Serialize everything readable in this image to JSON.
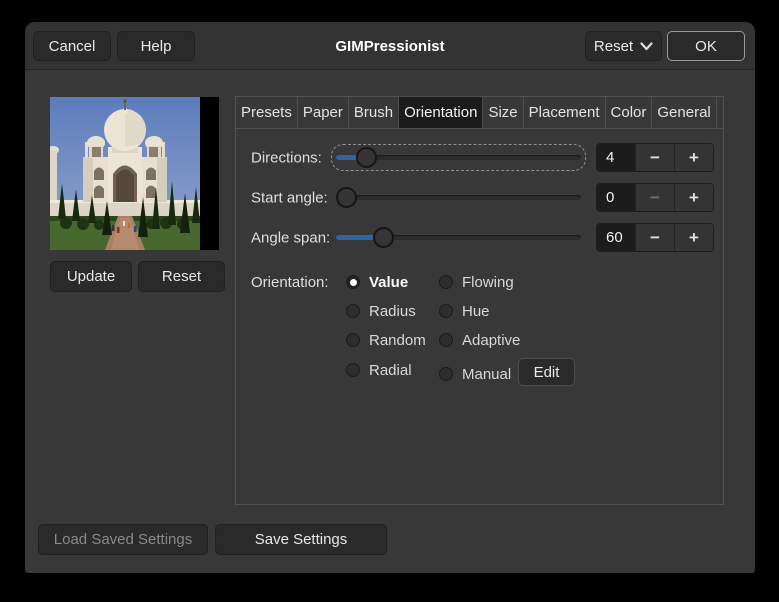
{
  "dialog": {
    "title": "GIMPressionist"
  },
  "header": {
    "cancel_label": "Cancel",
    "help_label": "Help",
    "reset_label": "Reset",
    "ok_label": "OK"
  },
  "preview": {
    "update_label": "Update",
    "reset_label": "Reset"
  },
  "tabs": [
    {
      "label": "Presets",
      "active": false
    },
    {
      "label": "Paper",
      "active": false
    },
    {
      "label": "Brush",
      "active": false
    },
    {
      "label": "Orientation",
      "active": true
    },
    {
      "label": "Size",
      "active": false
    },
    {
      "label": "Placement",
      "active": false
    },
    {
      "label": "Color",
      "active": false
    },
    {
      "label": "General",
      "active": false
    }
  ],
  "orientation": {
    "sliders": [
      {
        "label": "Directions:",
        "value": "4",
        "fraction": 0.09,
        "minus_disabled": false,
        "focused": true
      },
      {
        "label": "Start angle:",
        "value": "0",
        "fraction": 0.0,
        "minus_disabled": true,
        "focused": false
      },
      {
        "label": "Angle span:",
        "value": "60",
        "fraction": 0.167,
        "minus_disabled": false,
        "focused": false
      }
    ],
    "group_label": "Orientation:",
    "options": [
      {
        "label": "Value",
        "selected": true
      },
      {
        "label": "Radius",
        "selected": false
      },
      {
        "label": "Random",
        "selected": false
      },
      {
        "label": "Radial",
        "selected": false
      },
      {
        "label": "Flowing",
        "selected": false
      },
      {
        "label": "Hue",
        "selected": false
      },
      {
        "label": "Adaptive",
        "selected": false
      },
      {
        "label": "Manual",
        "selected": false
      }
    ],
    "edit_label": "Edit"
  },
  "footer": {
    "load_label": "Load Saved Settings",
    "load_disabled": true,
    "save_label": "Save Settings"
  },
  "icons": {
    "minus": "−",
    "plus": "+"
  },
  "colors": {
    "accent_blue": "#2d64a5",
    "dialog_bg": "#383838",
    "selected_tab_bg": "#1b1b1b",
    "entry_bg": "#1c1c1c"
  }
}
